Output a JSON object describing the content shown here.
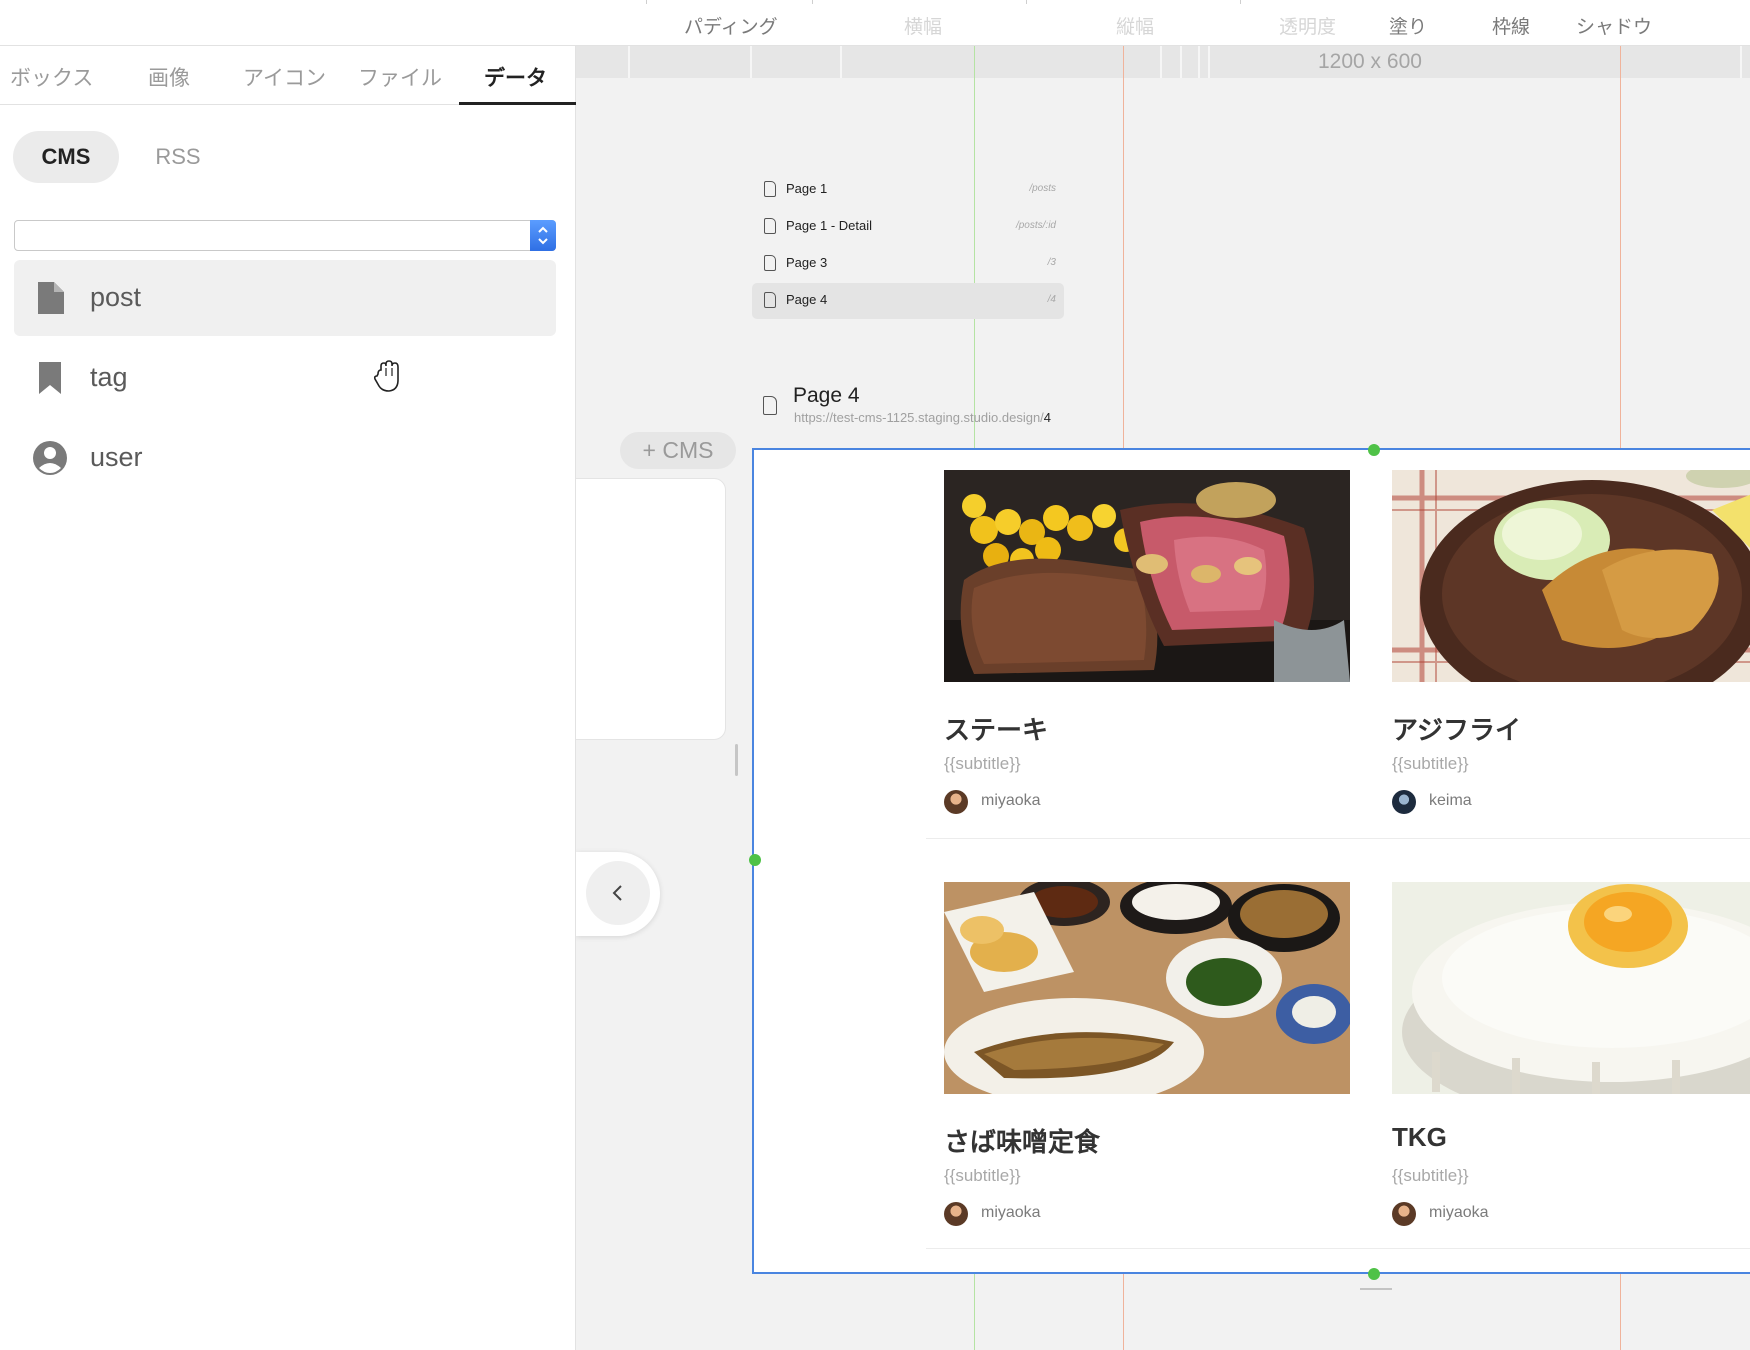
{
  "toolbar": {
    "items": [
      {
        "label": "パディング",
        "dim": false
      },
      {
        "label": "横幅",
        "dim": true
      },
      {
        "label": "縦幅",
        "dim": true
      },
      {
        "label": "透明度",
        "dim": true
      },
      {
        "label": "塗り",
        "dim": false
      },
      {
        "label": "枠線",
        "dim": false
      },
      {
        "label": "シャドウ",
        "dim": false
      }
    ]
  },
  "panel": {
    "tabs": [
      "ボックス",
      "画像",
      "アイコン",
      "ファイル",
      "データ"
    ],
    "active_tab": "データ",
    "segments": {
      "cms": "CMS",
      "rss": "RSS",
      "active": "CMS"
    },
    "select_value": "",
    "collections": [
      {
        "label": "post",
        "icon": "document-icon",
        "hovered": true
      },
      {
        "label": "tag",
        "icon": "bookmark-icon",
        "hovered": false
      },
      {
        "label": "user",
        "icon": "user-circle-icon",
        "hovered": false
      }
    ]
  },
  "canvas": {
    "size_label": "1200 x 600",
    "pages": [
      {
        "name": "Page 1",
        "path": "/posts",
        "selected": false
      },
      {
        "name": "Page 1 - Detail",
        "path": "/posts/:id",
        "selected": false
      },
      {
        "name": "Page 3",
        "path": "/3",
        "selected": false
      },
      {
        "name": "Page 4",
        "path": "/4",
        "selected": true
      }
    ],
    "current_page": {
      "title": "Page 4",
      "url_base": "https://test-cms-1125.staging.studio.design/",
      "url_suffix": "4"
    },
    "add_cms_label": "+ CMS",
    "back_icon": "chevron-left-icon"
  },
  "cards": [
    {
      "title": "ステーキ",
      "subtitle": "{{subtitle}}",
      "author": "miyaoka",
      "image": "steak-photo"
    },
    {
      "title": "アジフライ",
      "subtitle": "{{subtitle}}",
      "author": "keima",
      "image": "fried-fish-photo"
    },
    {
      "title": "さば味噌定食",
      "subtitle": "{{subtitle}}",
      "author": "miyaoka",
      "image": "set-meal-photo"
    },
    {
      "title": "TKG",
      "subtitle": "{{subtitle}}",
      "author": "miyaoka",
      "image": "egg-rice-photo"
    }
  ],
  "colors": {
    "accent_blue": "#4a85e0",
    "guide_green": "#b5e3a3",
    "guide_orange": "#f0b39b",
    "handle_green": "#4fc247"
  }
}
